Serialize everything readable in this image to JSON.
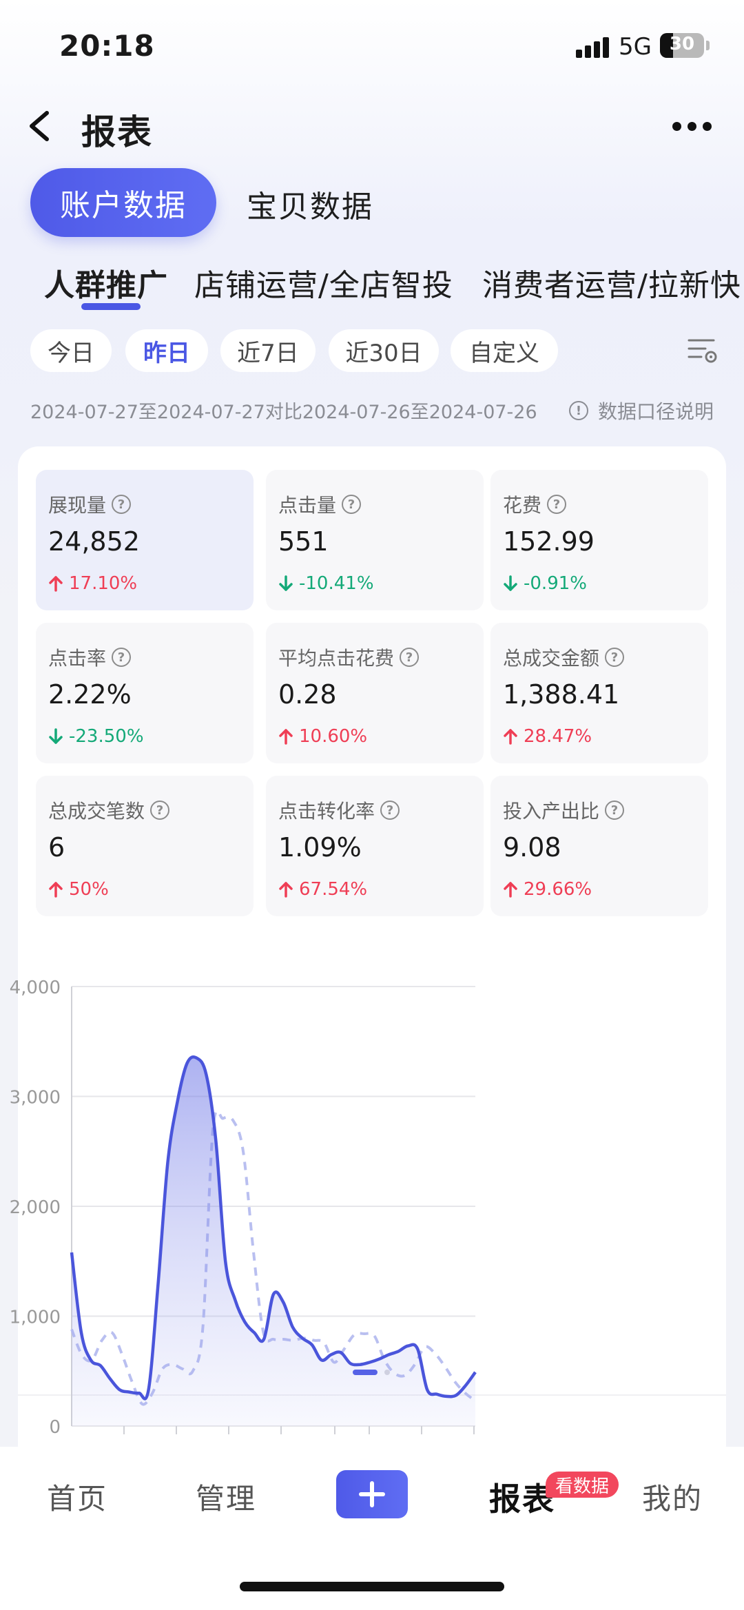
{
  "status_bar": {
    "time": "20:18",
    "network": "5G",
    "battery": "30",
    "battery_level": 0.3
  },
  "header": {
    "title": "报表"
  },
  "segments": {
    "active": "账户数据",
    "inactive": "宝贝数据"
  },
  "subnav": [
    "人群推广",
    "店铺运营/全店智投",
    "消费者运营/拉新快"
  ],
  "date_chips": [
    "今日",
    "昨日",
    "近7日",
    "近30日",
    "自定义"
  ],
  "date_range": "2024-07-27至2024-07-27对比2024-07-26至2024-07-26",
  "explain_label": "数据口径说明",
  "metrics": [
    {
      "label": "展现量",
      "value": "24,852",
      "delta": "17.10%",
      "dir": "up"
    },
    {
      "label": "点击量",
      "value": "551",
      "delta": "-10.41%",
      "dir": "down"
    },
    {
      "label": "花费",
      "value": "152.99",
      "delta": "-0.91%",
      "dir": "down"
    },
    {
      "label": "点击率",
      "value": "2.22%",
      "delta": "-23.50%",
      "dir": "down"
    },
    {
      "label": "平均点击花费",
      "value": "0.28",
      "delta": "10.60%",
      "dir": "up"
    },
    {
      "label": "总成交金额",
      "value": "1,388.41",
      "delta": "28.47%",
      "dir": "up"
    },
    {
      "label": "总成交笔数",
      "value": "6",
      "delta": "50%",
      "dir": "up"
    },
    {
      "label": "点击转化率",
      "value": "1.09%",
      "delta": "67.54%",
      "dir": "up"
    },
    {
      "label": "投入产出比",
      "value": "9.08",
      "delta": "29.66%",
      "dir": "up"
    }
  ],
  "chart_data": {
    "type": "line",
    "y_ticks": [
      "4,000",
      "3,000",
      "2,000",
      "1,000",
      "0"
    ],
    "ylim": [
      0,
      4000
    ],
    "grid": true,
    "x": [
      0,
      0.5,
      1,
      1.5,
      2,
      2.5,
      3,
      3.5,
      4,
      4.5,
      5,
      5.5,
      6,
      6.5,
      7,
      7.5,
      8,
      8.5,
      9,
      9.5,
      10,
      10.5,
      11,
      11.5,
      12,
      12.5,
      13,
      13.5,
      14,
      14.5,
      15,
      15.5,
      16,
      16.5,
      17,
      17.5,
      18,
      18.5,
      19,
      19.5,
      20,
      20.5,
      21,
      21.5,
      22,
      22.5,
      23
    ],
    "series": [
      {
        "style": "solid",
        "color": "#4a55db",
        "values": [
          1580,
          850,
          600,
          550,
          430,
          330,
          310,
          300,
          330,
          1300,
          2400,
          2950,
          3300,
          3350,
          3200,
          2600,
          1500,
          1150,
          950,
          850,
          790,
          1200,
          1130,
          900,
          800,
          740,
          600,
          650,
          670,
          570,
          560,
          580,
          610,
          650,
          680,
          730,
          700,
          330,
          290,
          270,
          280,
          370,
          490
        ]
      },
      {
        "style": "dashed",
        "color": "#b9bff0",
        "values": [
          880,
          650,
          600,
          780,
          850,
          650,
          400,
          200,
          300,
          520,
          560,
          520,
          500,
          900,
          2700,
          2800,
          2780,
          2500,
          1600,
          850,
          790,
          790,
          780,
          800,
          780,
          760,
          580,
          700,
          830,
          840,
          820,
          600,
          480,
          460,
          560,
          720,
          660,
          540,
          400,
          300,
          230
        ]
      }
    ]
  },
  "tabbar": {
    "home": "首页",
    "manage": "管理",
    "report": "报表",
    "badge": "看数据",
    "mine": "我的"
  }
}
